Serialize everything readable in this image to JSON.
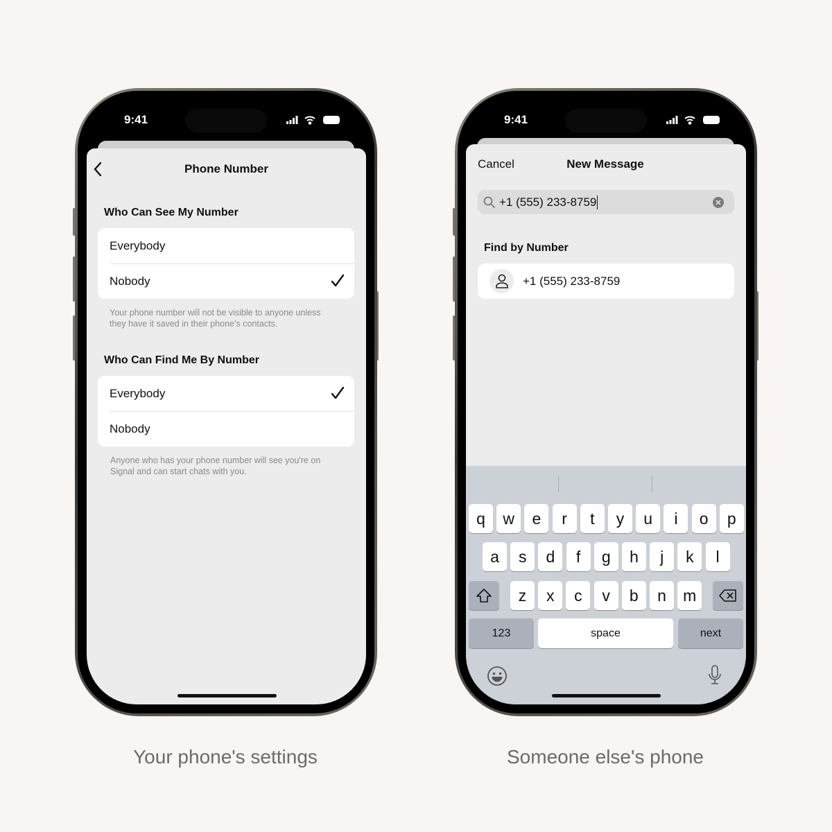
{
  "left_phone": {
    "status_time": "9:41",
    "nav_title": "Phone Number",
    "sections": [
      {
        "header": "Who Can See My Number",
        "options": [
          {
            "label": "Everybody",
            "selected": false
          },
          {
            "label": "Nobody",
            "selected": true
          }
        ],
        "footer": [
          "Your phone number will not be visible to anyone unless",
          "they have it saved in their phone’s contacts."
        ]
      },
      {
        "header": "Who Can Find Me By Number",
        "options": [
          {
            "label": "Everybody",
            "selected": true
          },
          {
            "label": "Nobody",
            "selected": false
          }
        ],
        "footer": [
          "Anyone who has your phone number will see you're on",
          "Signal and can start chats with you."
        ]
      }
    ],
    "caption": "Your phone's settings"
  },
  "right_phone": {
    "status_time": "9:41",
    "cancel_label": "Cancel",
    "nav_title": "New Message",
    "search_value": "+1 (555) 233-8759",
    "section_header": "Find by Number",
    "result_label": "+1 (555) 233-8759",
    "keyboard": {
      "row1": [
        "q",
        "w",
        "e",
        "r",
        "t",
        "y",
        "u",
        "i",
        "o",
        "p"
      ],
      "row2": [
        "a",
        "s",
        "d",
        "f",
        "g",
        "h",
        "j",
        "k",
        "l"
      ],
      "row3": [
        "z",
        "x",
        "c",
        "v",
        "b",
        "n",
        "m"
      ],
      "numbers_label": "123",
      "space_label": "space",
      "next_label": "next"
    },
    "caption": "Someone else's phone"
  }
}
